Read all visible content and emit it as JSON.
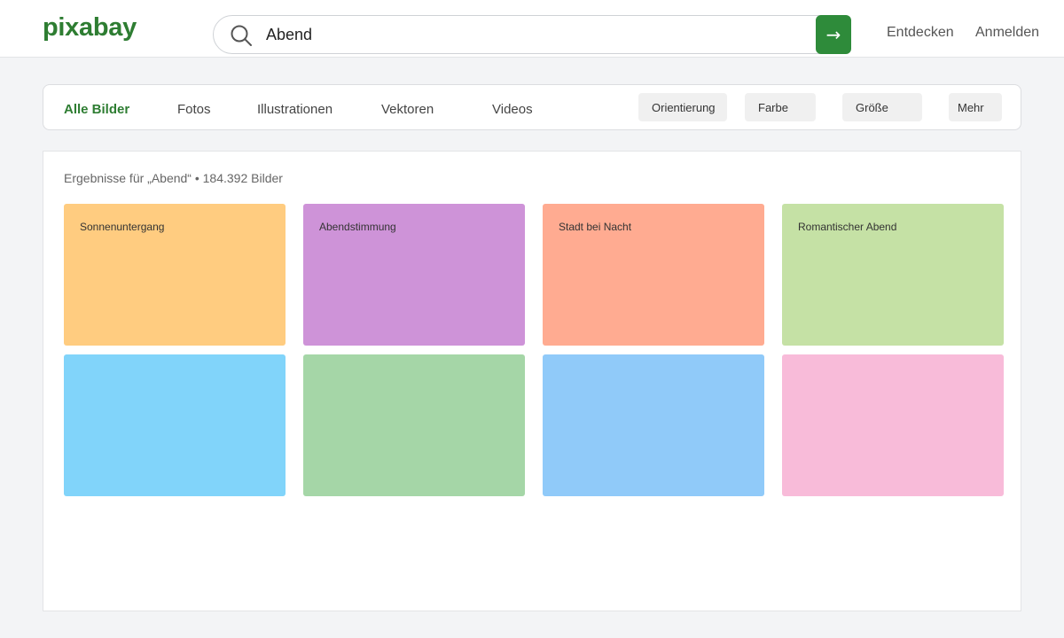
{
  "header": {
    "logo": "pixabay",
    "search": {
      "value": "Abend",
      "submit_glyph": "→"
    },
    "links": {
      "discover": "Entdecken",
      "login": "Anmelden"
    }
  },
  "filters": {
    "tabs": [
      {
        "label": "Alle Bilder",
        "active": true
      },
      {
        "label": "Fotos"
      },
      {
        "label": "Illustrationen"
      },
      {
        "label": "Vektoren"
      },
      {
        "label": "Videos"
      }
    ],
    "buttons": {
      "orientation": "Orientierung",
      "color": "Farbe",
      "size": "Größe",
      "more": "Mehr"
    }
  },
  "results": {
    "summary": "Ergebnisse für „Abend“ • 184.392 Bilder",
    "tiles": [
      {
        "label": "Sonnenuntergang",
        "color": "#ffcc80"
      },
      {
        "label": "Abendstimmung",
        "color": "#ce93d8"
      },
      {
        "label": "Stadt bei Nacht",
        "color": "#ffab91"
      },
      {
        "label": "Romantischer Abend",
        "color": "#c5e1a5"
      },
      {
        "label": "",
        "color": "#81d4fa"
      },
      {
        "label": "",
        "color": "#a5d6a7"
      },
      {
        "label": "",
        "color": "#90caf9"
      },
      {
        "label": "",
        "color": "#f8bbd9"
      }
    ]
  },
  "colors": {
    "brand": "#2e7d32",
    "submit": "#2e8b3a"
  }
}
